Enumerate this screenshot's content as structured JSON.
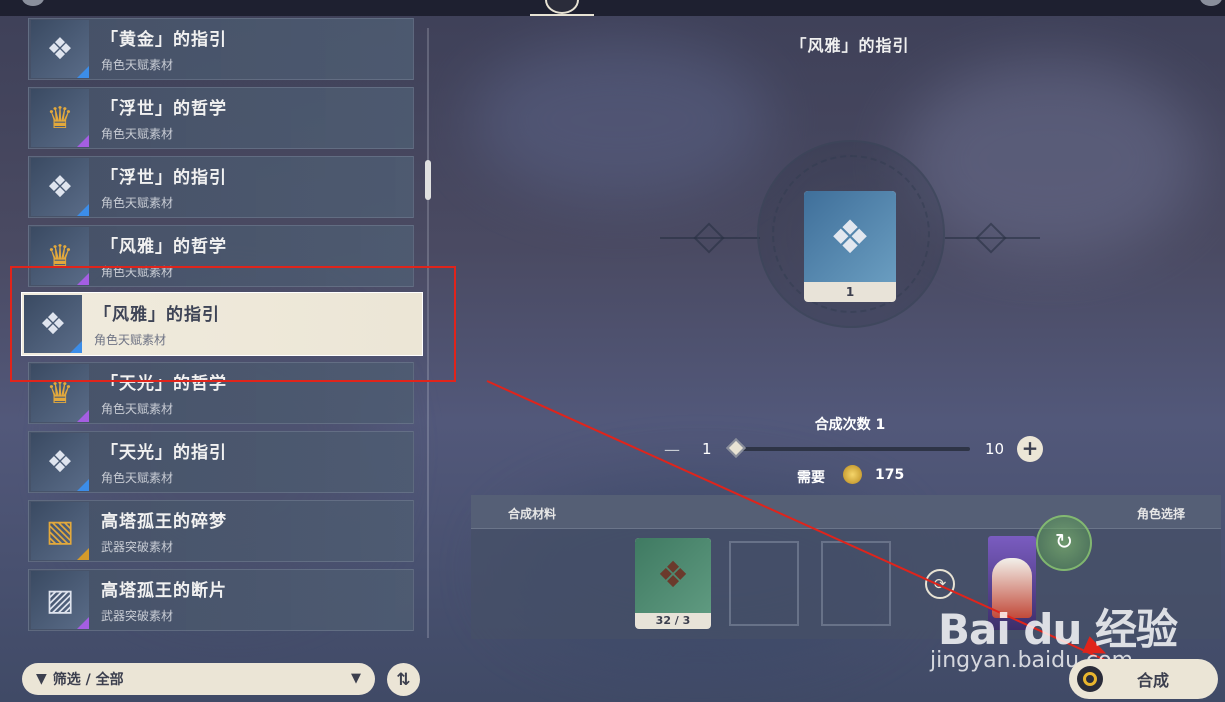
{
  "list": {
    "items": [
      {
        "name": "「黄金」的指引",
        "sub": "角色天赋素材",
        "icon": "scroll-guide",
        "rarity": "blue"
      },
      {
        "name": "「浮世」的哲学",
        "sub": "角色天赋素材",
        "icon": "crown-philosophy",
        "rarity": "purple"
      },
      {
        "name": "「浮世」的指引",
        "sub": "角色天赋素材",
        "icon": "scroll-guide",
        "rarity": "blue"
      },
      {
        "name": "「风雅」的哲学",
        "sub": "角色天赋素材",
        "icon": "crown-philosophy",
        "rarity": "purple"
      },
      {
        "name": "「风雅」的指引",
        "sub": "角色天赋素材",
        "icon": "scroll-guide",
        "rarity": "blue",
        "selected": true
      },
      {
        "name": "「天光」的哲学",
        "sub": "角色天赋素材",
        "icon": "crown-philosophy",
        "rarity": "purple"
      },
      {
        "name": "「天光」的指引",
        "sub": "角色天赋素材",
        "icon": "scroll-guide",
        "rarity": "blue"
      },
      {
        "name": "高塔孤王的碎梦",
        "sub": "武器突破素材",
        "icon": "dream-fragment",
        "rarity": "gold"
      },
      {
        "name": "高塔孤王的断片",
        "sub": "武器突破素材",
        "icon": "stone-fragment",
        "rarity": "purple"
      }
    ]
  },
  "filter": {
    "label": "筛选 / 全部"
  },
  "detail": {
    "title": "「风雅」的指引",
    "result_count": "1",
    "craft_times_label": "合成次数 1",
    "slider_min": "1",
    "slider_max": "10",
    "need_label": "需要",
    "need_value": "175",
    "materials_label": "合成材料",
    "character_label": "角色选择",
    "material_count": "32 / 3",
    "synth_label": "合成"
  },
  "watermark": {
    "brand": "Bai du 经验",
    "url": "jingyan.baidu.com"
  },
  "colors": {
    "highlight": "#e0241b",
    "panel": "#ebe5d6",
    "rarity_blue": "#3c8de8",
    "rarity_purple": "#a45ee2"
  }
}
